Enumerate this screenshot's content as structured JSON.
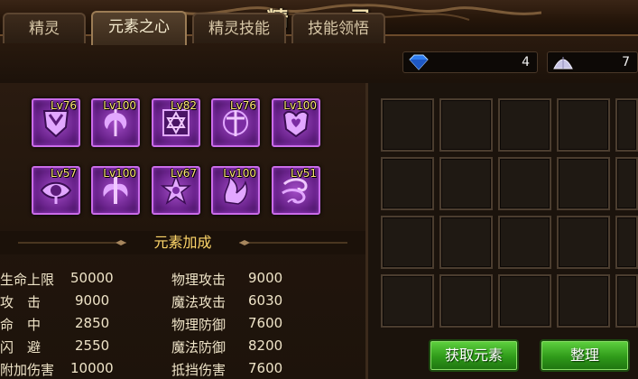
{
  "window": {
    "title": "精 灵"
  },
  "tabs": [
    {
      "label": "精灵",
      "active": false
    },
    {
      "label": "元素之心",
      "active": true
    },
    {
      "label": "精灵技能",
      "active": false
    },
    {
      "label": "技能领悟",
      "active": false
    }
  ],
  "currency": {
    "diamond": {
      "value": "4",
      "icon": "blue-diamond-icon"
    },
    "crystal": {
      "value": "7",
      "icon": "silver-crystal-icon"
    }
  },
  "elements": [
    {
      "level": "Lv76",
      "icon": "shield-emblem-icon"
    },
    {
      "level": "Lv100",
      "icon": "axe-icon"
    },
    {
      "level": "Lv82",
      "icon": "hexagram-icon"
    },
    {
      "level": "Lv76",
      "icon": "sword-cross-icon"
    },
    {
      "level": "Lv100",
      "icon": "heart-emblem-icon"
    },
    {
      "level": "Lv57",
      "icon": "eye-icon"
    },
    {
      "level": "Lv100",
      "icon": "winged-sword-icon"
    },
    {
      "level": "Lv67",
      "icon": "star-burst-icon"
    },
    {
      "level": "Lv100",
      "icon": "flame-claw-icon"
    },
    {
      "level": "Lv51",
      "icon": "wind-swirl-icon"
    }
  ],
  "bonus": {
    "title": "元素加成",
    "left": [
      {
        "label": "生命上限",
        "value": "50000"
      },
      {
        "label": "攻　击",
        "value": "9000"
      },
      {
        "label": "命　中",
        "value": "2850"
      },
      {
        "label": "闪　避",
        "value": "2550"
      },
      {
        "label": "附加伤害",
        "value": "10000"
      }
    ],
    "right": [
      {
        "label": "物理攻击",
        "value": "9000"
      },
      {
        "label": "魔法攻击",
        "value": "6030"
      },
      {
        "label": "物理防御",
        "value": "7600"
      },
      {
        "label": "魔法防御",
        "value": "8200"
      },
      {
        "label": "抵挡伤害",
        "value": "7600"
      }
    ]
  },
  "buttons": {
    "acquire": "获取元素",
    "sort": "整理"
  },
  "colors": {
    "accent_gold": "#ffd76a",
    "slot_purple": "#a34cc7",
    "button_green": "#3fae24"
  }
}
